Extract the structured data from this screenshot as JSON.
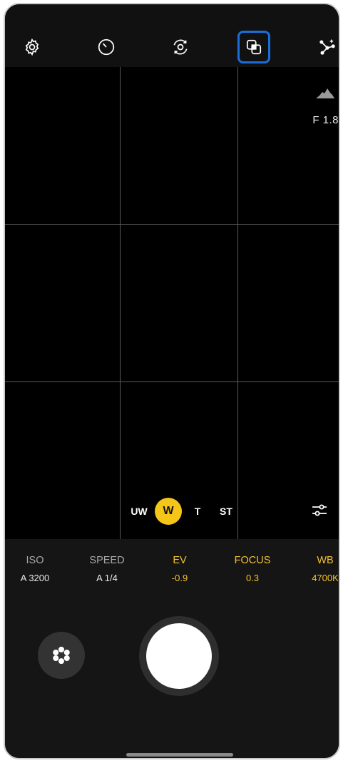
{
  "topbar": {
    "icons": [
      "gear-icon",
      "timer-icon",
      "motion-photo-icon",
      "overlay-icon",
      "star-trail-icon"
    ],
    "selected_icon": "overlay-icon"
  },
  "viewfinder": {
    "aperture": "F 1.8",
    "zoom_options": [
      {
        "label": "UW",
        "active": false
      },
      {
        "label": "W",
        "active": true
      },
      {
        "label": "T",
        "active": false
      },
      {
        "label": "ST",
        "active": false
      }
    ]
  },
  "params": [
    {
      "label": "ISO",
      "value": "A 3200",
      "highlight": false
    },
    {
      "label": "SPEED",
      "value": "A 1/4",
      "highlight": false
    },
    {
      "label": "EV",
      "value": "-0.9",
      "highlight": true
    },
    {
      "label": "FOCUS",
      "value": "0.3",
      "highlight": true
    },
    {
      "label": "WB",
      "value": "4700K",
      "highlight": true
    }
  ],
  "colors": {
    "accent_yellow": "#f5c518",
    "selection_blue": "#1a6ed8",
    "param_highlight": "#f2c12e"
  }
}
